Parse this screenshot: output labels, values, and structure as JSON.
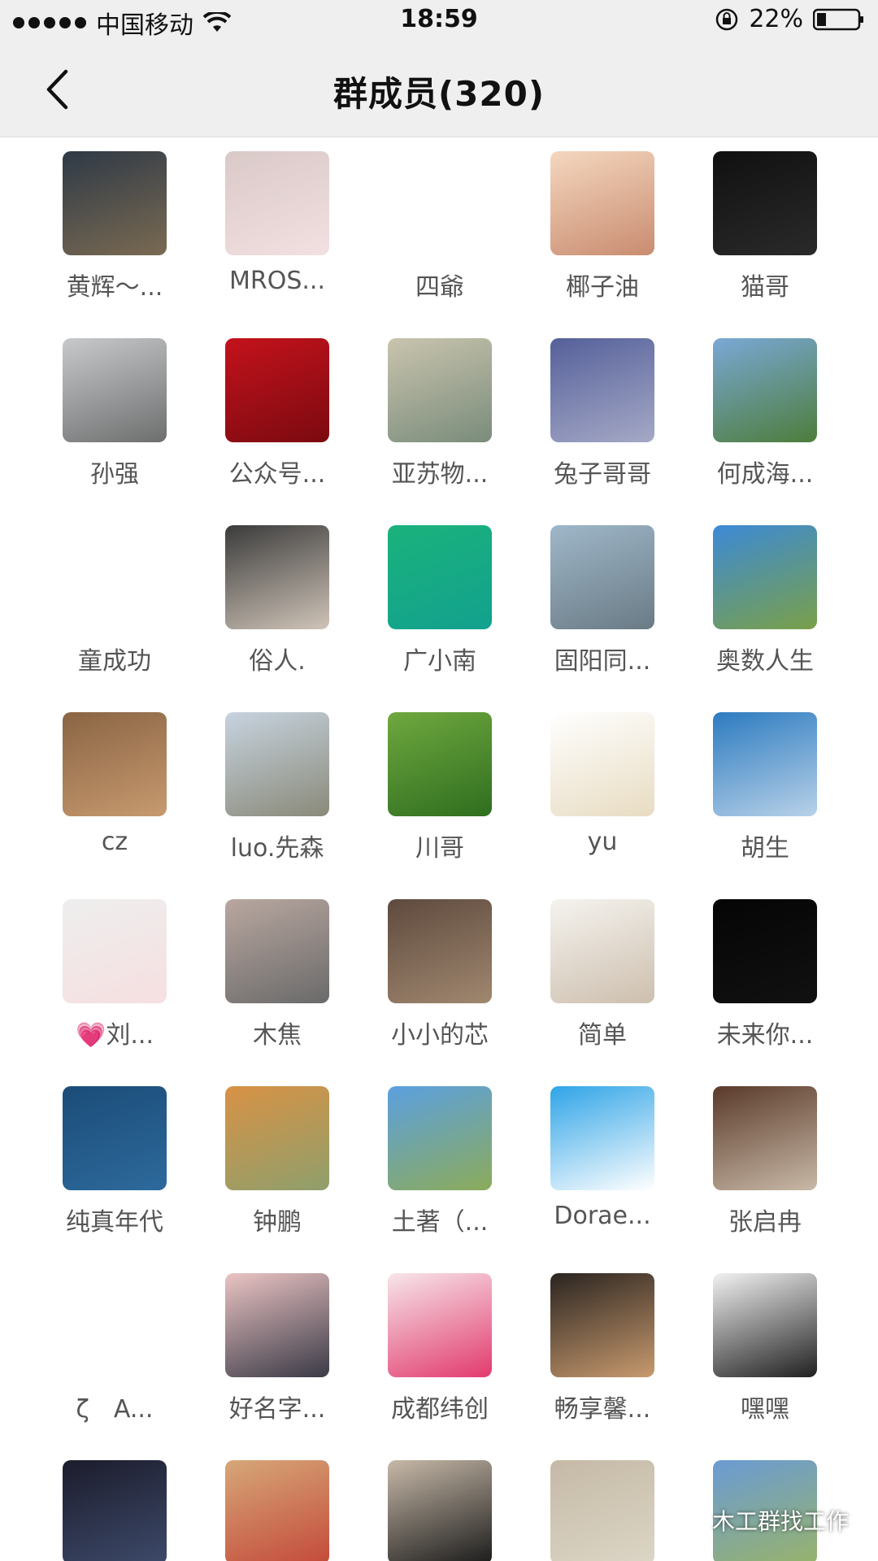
{
  "status_bar": {
    "carrier": "中国移动",
    "time": "18:59",
    "battery": "22%"
  },
  "nav": {
    "title": "群成员(320)"
  },
  "members": [
    {
      "name": "黄辉～...",
      "colors": [
        "#2e3946",
        "#7a6a52"
      ]
    },
    {
      "name": "MROS...",
      "colors": [
        "#d9c9c7",
        "#f3e0e2"
      ]
    },
    {
      "name": "四爺",
      "colors": [
        "#ffffff",
        "#ffffff"
      ]
    },
    {
      "name": "椰子油",
      "colors": [
        "#f4d7bf",
        "#c98c70"
      ]
    },
    {
      "name": "猫哥",
      "colors": [
        "#101010",
        "#2a2a2a"
      ]
    },
    {
      "name": "孙强",
      "colors": [
        "#c7c9cb",
        "#6d6f6f"
      ]
    },
    {
      "name": "公众号...",
      "colors": [
        "#c4121c",
        "#7b0a10"
      ]
    },
    {
      "name": "亚苏物...",
      "colors": [
        "#c9c4ae",
        "#7a8c7b"
      ]
    },
    {
      "name": "兔子哥哥",
      "colors": [
        "#55609a",
        "#a5a9c6"
      ]
    },
    {
      "name": "何成海...",
      "colors": [
        "#7aa8d6",
        "#4d7d3b"
      ]
    },
    {
      "name": "童成功",
      "colors": [
        "#ffffff",
        "#ffffff"
      ]
    },
    {
      "name": "俗人.",
      "colors": [
        "#3b3b3b",
        "#cfc4b8"
      ]
    },
    {
      "name": "广小南",
      "colors": [
        "#1bb27b",
        "#12a18f"
      ]
    },
    {
      "name": "固阳同...",
      "colors": [
        "#9fb7c9",
        "#6a7b85"
      ]
    },
    {
      "name": "奥数人生",
      "colors": [
        "#3c8ad6",
        "#7aa049"
      ]
    },
    {
      "name": "cz",
      "colors": [
        "#8a6444",
        "#c79a6f"
      ]
    },
    {
      "name": "luo.先森",
      "colors": [
        "#c7d3df",
        "#8a8a7a"
      ]
    },
    {
      "name": "川哥",
      "colors": [
        "#6fa83f",
        "#2f6e1f"
      ]
    },
    {
      "name": "yu",
      "colors": [
        "#ffffff",
        "#e8dcc2"
      ]
    },
    {
      "name": "胡生",
      "colors": [
        "#2c7bc0",
        "#b8d1e8"
      ]
    },
    {
      "name": "💗刘...",
      "colors": [
        "#eeeeee",
        "#f6dfe0"
      ]
    },
    {
      "name": "木焦",
      "colors": [
        "#b9a7a0",
        "#6a6a6a"
      ]
    },
    {
      "name": "小小的芯",
      "colors": [
        "#5e4a3e",
        "#a0876f"
      ]
    },
    {
      "name": "简单",
      "colors": [
        "#f5f3ef",
        "#cdbfae"
      ]
    },
    {
      "name": "未来你...",
      "colors": [
        "#050505",
        "#111111"
      ]
    },
    {
      "name": "纯真年代",
      "colors": [
        "#1b4c78",
        "#2d6a9c"
      ]
    },
    {
      "name": "钟鹏",
      "colors": [
        "#d89245",
        "#8f9f6c"
      ]
    },
    {
      "name": "土著（...",
      "colors": [
        "#5ba0e0",
        "#8cab5a"
      ]
    },
    {
      "name": "Dorae...",
      "colors": [
        "#2fa4e7",
        "#ffffff"
      ]
    },
    {
      "name": "张启冉",
      "colors": [
        "#5a3a2a",
        "#c9b9a7"
      ]
    },
    {
      "name": "ζ　A...",
      "colors": [
        "#ffffff",
        "#ffffff"
      ]
    },
    {
      "name": "好名字...",
      "colors": [
        "#ebc4c4",
        "#3a3a46"
      ]
    },
    {
      "name": "成都纬创",
      "colors": [
        "#f7e6ea",
        "#e23a6e"
      ]
    },
    {
      "name": "畅享馨...",
      "colors": [
        "#2a2420",
        "#c89a6e"
      ]
    },
    {
      "name": "嘿嘿",
      "colors": [
        "#f2f2f2",
        "#202020"
      ]
    },
    {
      "name": "",
      "colors": [
        "#1c1c2c",
        "#3d4a6a"
      ]
    },
    {
      "name": "",
      "colors": [
        "#d6a778",
        "#c44a3a"
      ]
    },
    {
      "name": "",
      "colors": [
        "#c7b9a8",
        "#1b1b1b"
      ]
    },
    {
      "name": "",
      "colors": [
        "#c5b9a6",
        "#dcd6c6"
      ]
    },
    {
      "name": "",
      "colors": [
        "#6a9bd4",
        "#98b36b"
      ]
    }
  ],
  "watermark": {
    "text": "木工群找工作"
  }
}
